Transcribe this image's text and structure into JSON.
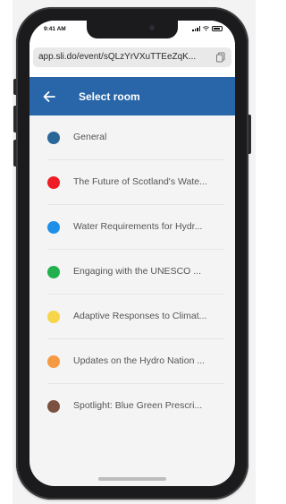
{
  "status_bar": {
    "time": "9:41 AM"
  },
  "browser": {
    "url": "app.sli.do/event/sQLzYrVXuTTEeZqK..."
  },
  "header": {
    "title": "Select room"
  },
  "rooms": [
    {
      "label": "General",
      "color": "#2a6799"
    },
    {
      "label": "The Future of Scotland's Wate...",
      "color": "#ee1d25"
    },
    {
      "label": "Water Requirements for Hydr...",
      "color": "#1f8fea"
    },
    {
      "label": "Engaging with the UNESCO ...",
      "color": "#22b04f"
    },
    {
      "label": "Adaptive Responses to Climat...",
      "color": "#f6d54a"
    },
    {
      "label": "Updates on the Hydro Nation ...",
      "color": "#f59a43"
    },
    {
      "label": "Spotlight: Blue Green Prescri...",
      "color": "#7b5241"
    }
  ],
  "icons": {
    "back": "arrow-left-icon",
    "copy": "copy-icon"
  }
}
